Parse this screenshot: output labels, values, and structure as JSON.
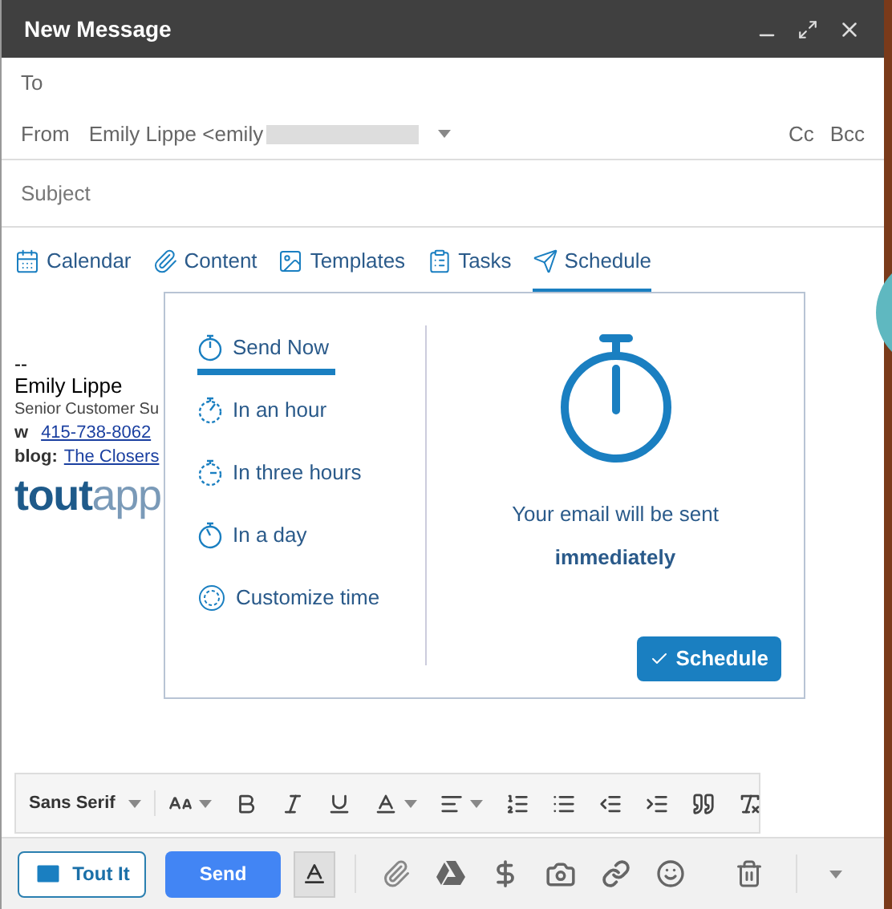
{
  "window": {
    "title": "New Message"
  },
  "to": {
    "label": "To"
  },
  "from": {
    "label": "From",
    "value": "Emily Lippe <emily",
    "cc": "Cc",
    "bcc": "Bcc"
  },
  "subject": {
    "placeholder": "Subject"
  },
  "tabs": [
    {
      "kind": "calendar",
      "label": "Calendar",
      "selected": false
    },
    {
      "kind": "content",
      "label": "Content",
      "selected": false
    },
    {
      "kind": "templates",
      "label": "Templates",
      "selected": false
    },
    {
      "kind": "tasks",
      "label": "Tasks",
      "selected": false
    },
    {
      "kind": "schedule",
      "label": "Schedule",
      "selected": true
    }
  ],
  "signature": {
    "dashes": "--",
    "name": "Emily Lippe",
    "title": "Senior Customer Su",
    "phone_label": "w",
    "phone": "415-738-8062",
    "blog_label": "blog:",
    "blog": "The Closers",
    "logo_bold": "tout",
    "logo_light": "app"
  },
  "schedule": {
    "options": [
      {
        "kind": "now",
        "label": "Send Now",
        "selected": true
      },
      {
        "kind": "hour",
        "label": "In an hour",
        "selected": false
      },
      {
        "kind": "three",
        "label": "In three hours",
        "selected": false
      },
      {
        "kind": "day",
        "label": "In a day",
        "selected": false
      },
      {
        "kind": "custom",
        "label": "Customize time",
        "selected": false
      }
    ],
    "message": "Your email will be sent",
    "when": "immediately",
    "button": "Schedule"
  },
  "format_toolbar": {
    "font": "Sans Serif"
  },
  "bottom_bar": {
    "tout_button": "Tout It",
    "send_button": "Send"
  }
}
